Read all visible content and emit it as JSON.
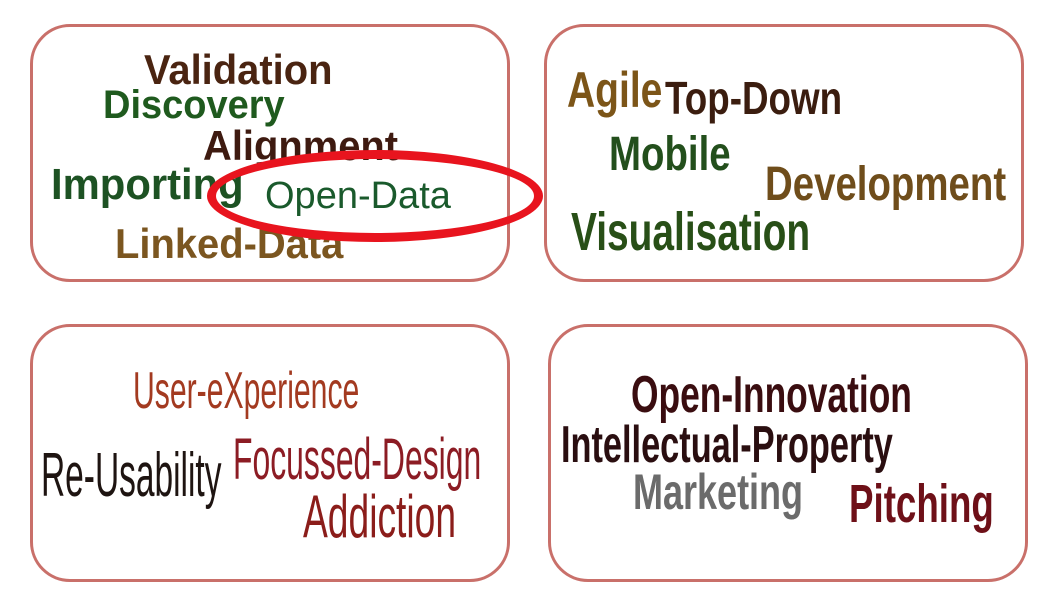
{
  "colors": {
    "card_border": "#c9706a",
    "highlight_ring": "#e8141e"
  },
  "clouds": {
    "c1": {
      "words": [
        {
          "text": "Validation",
          "color": "#4a2411"
        },
        {
          "text": "Discovery",
          "color": "#1f5a1e"
        },
        {
          "text": "Alignment",
          "color": "#3e1a10"
        },
        {
          "text": "Importing",
          "color": "#1d5223"
        },
        {
          "text": "Open-Data",
          "color": "#1a5a2c"
        },
        {
          "text": "Linked-Data",
          "color": "#7b5620"
        }
      ],
      "highlighted_word": "Open-Data"
    },
    "c2": {
      "words": [
        {
          "text": "Agile",
          "color": "#7c5518"
        },
        {
          "text": "Top-Down",
          "color": "#3b1d0f"
        },
        {
          "text": "Mobile",
          "color": "#234f1c"
        },
        {
          "text": "Development",
          "color": "#6f4d1b"
        },
        {
          "text": "Visualisation",
          "color": "#284f17"
        }
      ]
    },
    "c3": {
      "words": [
        {
          "text": "User-eXperience",
          "color": "#a33a20"
        },
        {
          "text": "Re-Usability",
          "color": "#1e1411"
        },
        {
          "text": "Focussed-Design",
          "color": "#8c1c24"
        },
        {
          "text": "Addiction",
          "color": "#8b1d1a"
        }
      ]
    },
    "c4": {
      "words": [
        {
          "text": "Open-Innovation",
          "color": "#3a0d10"
        },
        {
          "text": "Intellectual-Property",
          "color": "#2a0e10"
        },
        {
          "text": "Marketing",
          "color": "#6b6b6b"
        },
        {
          "text": "Pitching",
          "color": "#6e1018"
        }
      ]
    }
  }
}
